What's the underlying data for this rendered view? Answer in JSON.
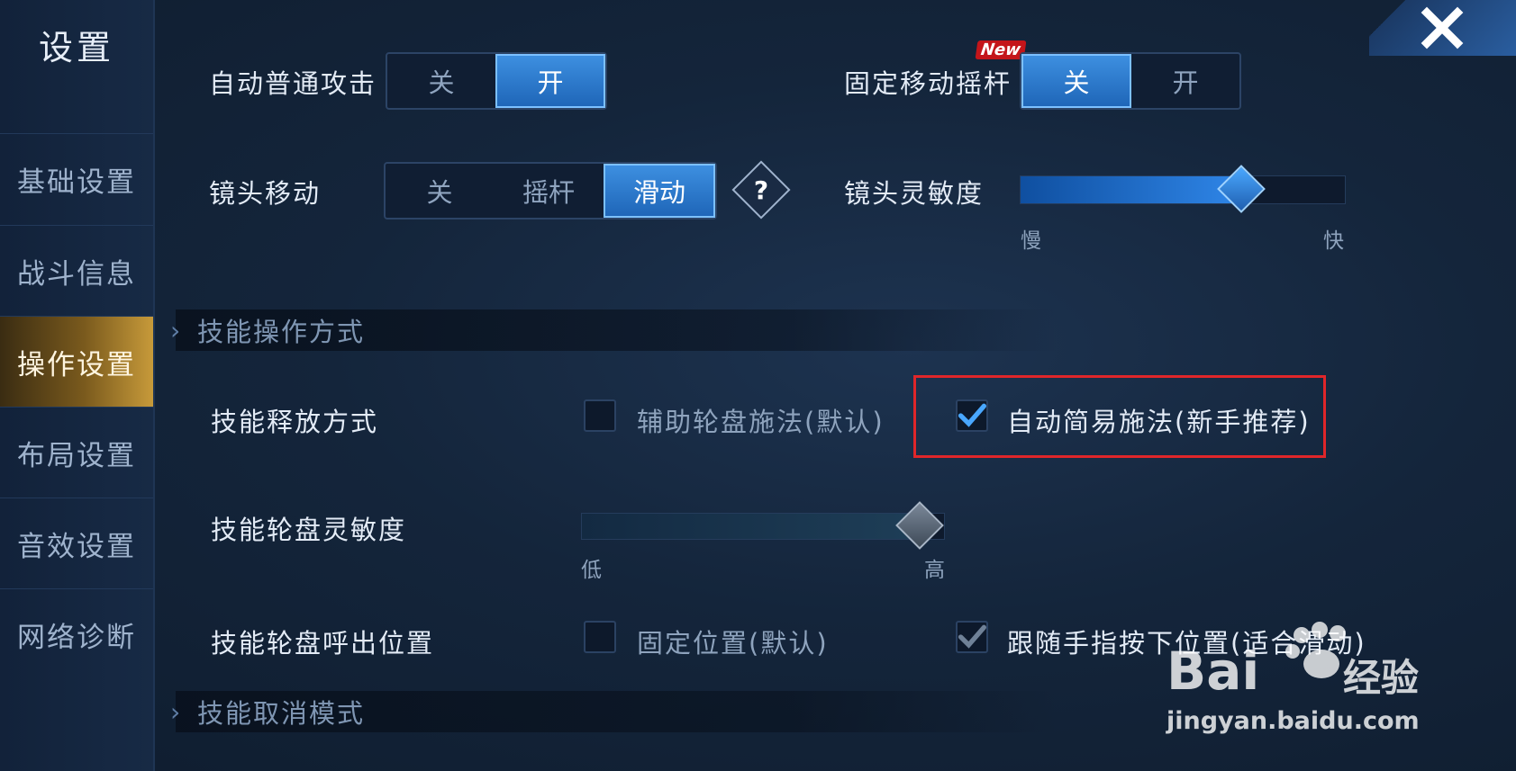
{
  "sidebar": {
    "title": "设置",
    "items": [
      {
        "label": "基础设置"
      },
      {
        "label": "战斗信息"
      },
      {
        "label": "操作设置"
      },
      {
        "label": "布局设置"
      },
      {
        "label": "音效设置"
      },
      {
        "label": "网络诊断"
      }
    ],
    "active_index": 2
  },
  "auto_attack": {
    "label": "自动普通攻击",
    "options": [
      "关",
      "开"
    ],
    "selected": "开"
  },
  "fixed_joystick": {
    "label": "固定移动摇杆",
    "badge": "New",
    "options": [
      "关",
      "开"
    ],
    "selected": "关"
  },
  "camera_move": {
    "label": "镜头移动",
    "options": [
      "关",
      "摇杆",
      "滑动"
    ],
    "selected": "滑动",
    "help": "?"
  },
  "camera_sensitivity": {
    "label": "镜头灵敏度",
    "min_label": "慢",
    "max_label": "快",
    "value_fraction": 0.68
  },
  "skill_section": {
    "title": "技能操作方式"
  },
  "skill_release": {
    "label": "技能释放方式",
    "options": [
      {
        "label": "辅助轮盘施法(默认)",
        "checked": false
      },
      {
        "label": "自动简易施法(新手推荐)",
        "checked": true
      }
    ]
  },
  "wheel_sensitivity": {
    "label": "技能轮盘灵敏度",
    "min_label": "低",
    "max_label": "高",
    "value_fraction": 1.0
  },
  "wheel_position": {
    "label": "技能轮盘呼出位置",
    "options": [
      {
        "label": "固定位置(默认)",
        "checked": false
      },
      {
        "label": "跟随手指按下位置(适合滑动)",
        "checked": true
      }
    ]
  },
  "cancel_section": {
    "title": "技能取消模式"
  },
  "watermark": {
    "brand": "Bai",
    "brand_cn": "经验",
    "url": "jingyan.baidu.com"
  },
  "colors": {
    "accent": "#2f7fd6",
    "highlight": "#e0262a",
    "active_tab": "#c79a3a"
  }
}
